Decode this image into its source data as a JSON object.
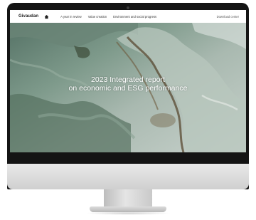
{
  "site": {
    "brand": "Givaudan",
    "nav": [
      "A year in review",
      "Value creation",
      "Environment and social progress"
    ],
    "download": "Download center",
    "hero_title_line1": "2023 Integrated report",
    "hero_title_line2": "on economic and ESG performance"
  },
  "colors": {
    "bezel": "#141414",
    "chin": "#dcdcdc",
    "topbar": "#ffffff",
    "hero_text": "#ffffff"
  },
  "icons": {
    "home": "home-icon",
    "camera": "camera-dot"
  }
}
